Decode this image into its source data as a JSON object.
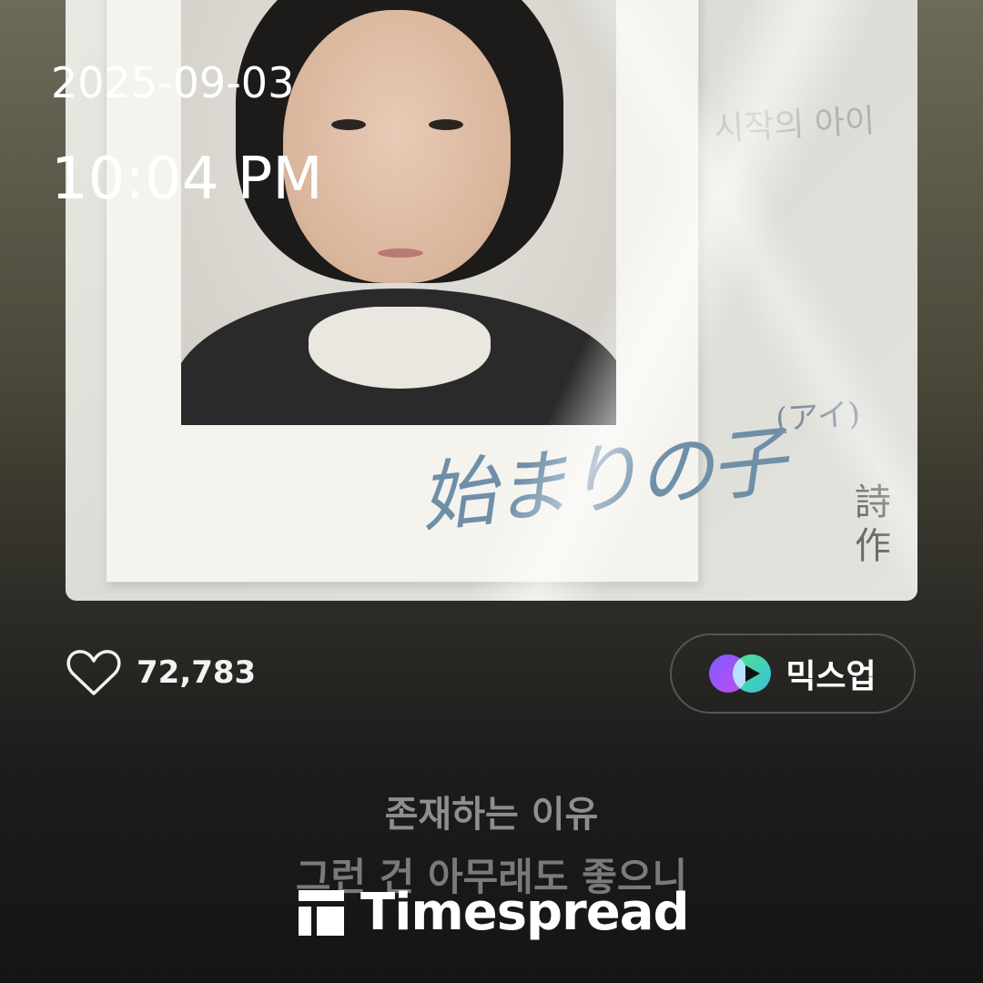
{
  "status": {
    "date": "2025-09-03",
    "time": "10:04 PM"
  },
  "album_art": {
    "handwritten_title": "始まりの子",
    "handwritten_reading": "(アイ)",
    "handwritten_korean": "시작의 아이",
    "stamp_line1": "詩",
    "stamp_line2": "作"
  },
  "actions": {
    "like_count": "72,783",
    "like_icon": "heart-outline-icon",
    "mixup_label": "믹스업",
    "mixup_icon": "mixup-icon"
  },
  "lyrics": {
    "line1": "존재하는 이유",
    "line2": "그런 건 아무래도 좋으니"
  },
  "watermark": {
    "text": "Timespread"
  }
}
